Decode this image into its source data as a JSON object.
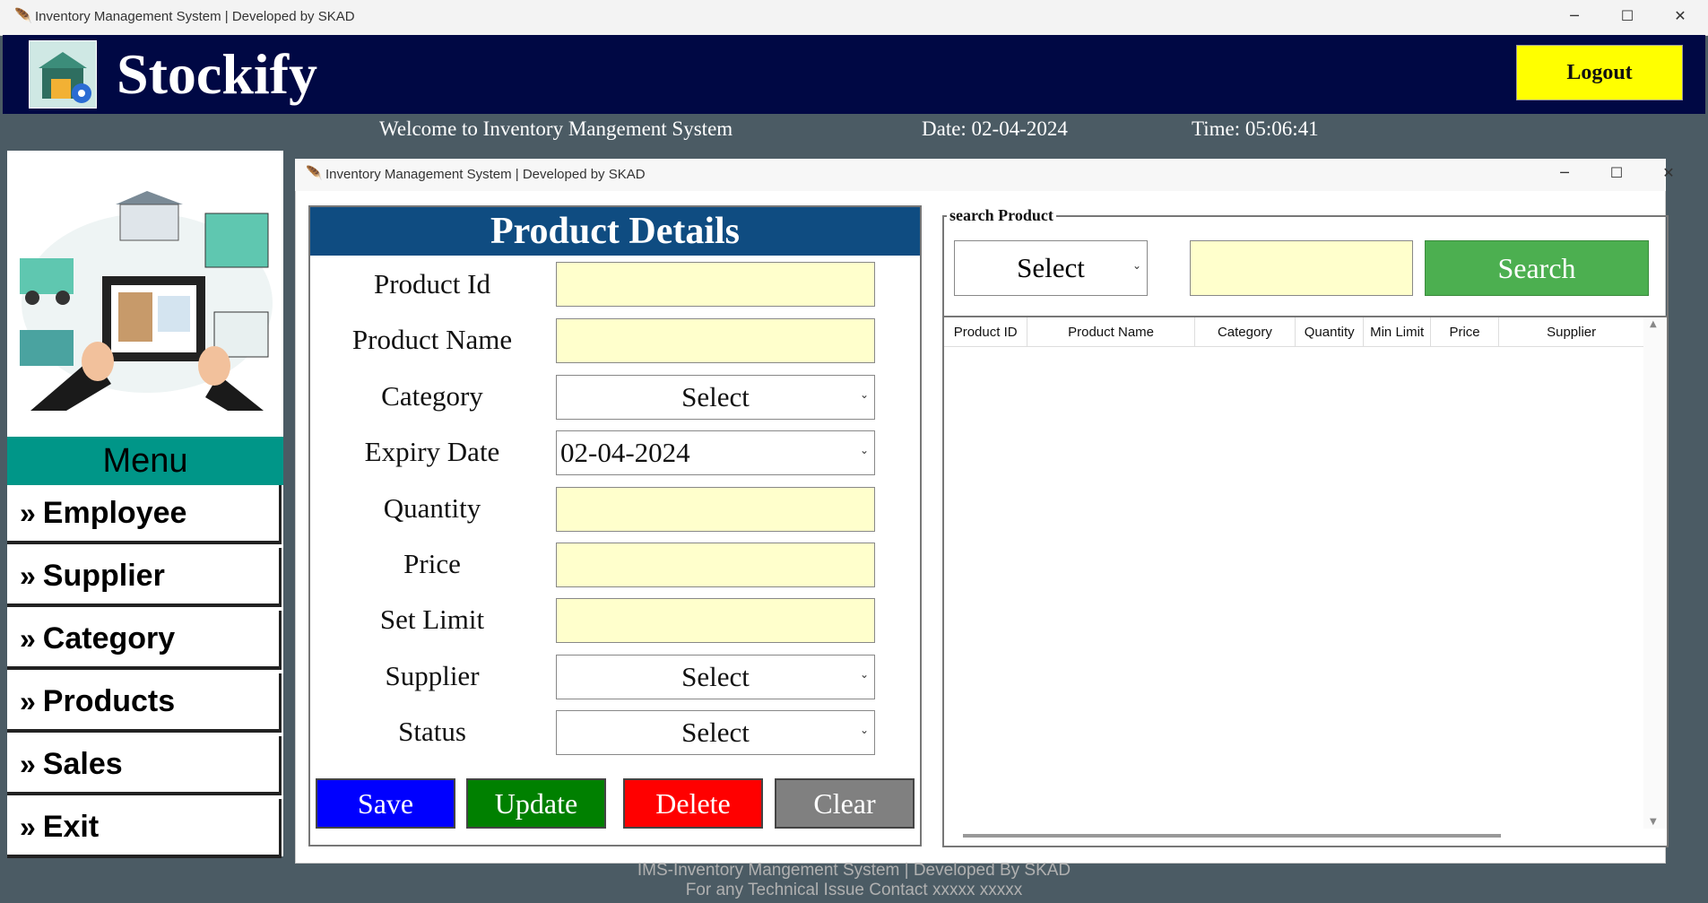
{
  "outer_window": {
    "title": "Inventory Management System | Developed by SKAD"
  },
  "header": {
    "brand": "Stockify",
    "logout_label": "Logout"
  },
  "subbar": {
    "welcome": "Welcome to Inventory Mangement System",
    "date": "Date: 02-04-2024",
    "time": "Time: 05:06:41"
  },
  "menu": {
    "title": "Menu",
    "items": [
      "Employee",
      "Supplier",
      "Category",
      "Products",
      "Sales",
      "Exit"
    ]
  },
  "inner_window": {
    "title": "Inventory Management System | Developed by SKAD"
  },
  "product_details": {
    "heading": "Product Details",
    "labels": {
      "product_id": "Product Id",
      "product_name": "Product Name",
      "category": "Category",
      "expiry_date": "Expiry Date",
      "quantity": "Quantity",
      "price": "Price",
      "set_limit": "Set Limit",
      "supplier": "Supplier",
      "status": "Status"
    },
    "values": {
      "product_id": "",
      "product_name": "",
      "category": "Select",
      "expiry_date": "02-04-2024",
      "quantity": "",
      "price": "",
      "set_limit": "",
      "supplier": "Select",
      "status": "Select"
    },
    "buttons": {
      "save": "Save",
      "update": "Update",
      "delete": "Delete",
      "clear": "Clear"
    },
    "colors": {
      "header": "#0f4c81",
      "save": "#0000ff",
      "update": "#008000",
      "delete": "#ff0000",
      "clear": "#808080"
    }
  },
  "search": {
    "legend": "search Product",
    "select_value": "Select",
    "input_value": "",
    "button": "Search"
  },
  "table": {
    "columns": [
      "Product ID",
      "Product Name",
      "Category",
      "Quantity",
      "Min Limit",
      "Price",
      "Supplier"
    ],
    "rows": []
  },
  "footer": {
    "line1": "IMS-Inventory Mangement System | Developed By SKAD",
    "line2": "For any Technical Issue Contact xxxxx xxxxx"
  }
}
